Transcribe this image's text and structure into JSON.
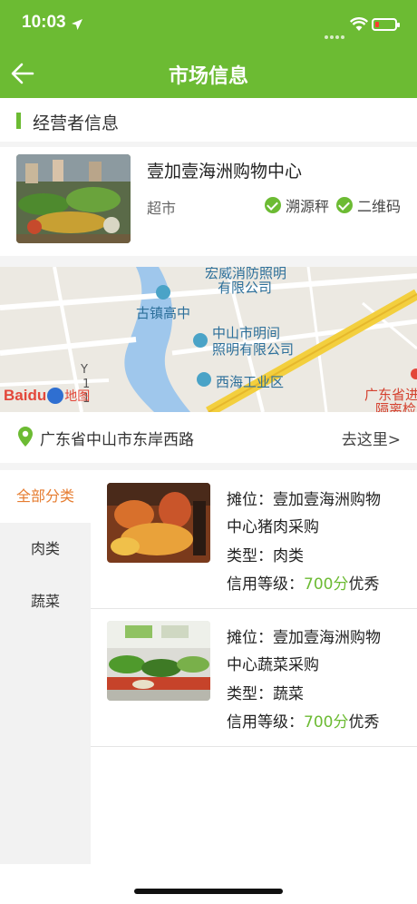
{
  "status": {
    "time": "10:03"
  },
  "nav": {
    "title": "市场信息"
  },
  "section": {
    "title": "经营者信息"
  },
  "vendor": {
    "name": "壹加壹海洲购物中心",
    "type": "超市",
    "tags": [
      "溯源秤",
      "二维码"
    ]
  },
  "map": {
    "labels": [
      "宏威消防照明",
      "有限公司",
      "古镇高中",
      "中山市明间",
      "照明有限公司",
      "西海工业区",
      "广东省进",
      "隔离检",
      "Baidu",
      "地图",
      "Y",
      "1",
      "1"
    ]
  },
  "address": {
    "text": "广东省中山市东岸西路",
    "go_label": "去这里>"
  },
  "categories": [
    {
      "label": "全部分类",
      "active": true
    },
    {
      "label": "肉类",
      "active": false
    },
    {
      "label": "蔬菜",
      "active": false
    }
  ],
  "stalls": [
    {
      "line1": "摊位：壹加壹海洲购物",
      "line2": "中心猪肉采购",
      "type_line": "类型：肉类",
      "credit_prefix": "信用等级：",
      "score": "700分",
      "grade": "优秀"
    },
    {
      "line1": "摊位：壹加壹海洲购物",
      "line2": "中心蔬菜采购",
      "type_line": "类型：蔬菜",
      "credit_prefix": "信用等级：",
      "score": "700分",
      "grade": "优秀"
    }
  ],
  "colors": {
    "brand": "#6cbb33",
    "active_category": "#e67d31",
    "score": "#6cbb33"
  },
  "icons": {
    "back": "back-arrow-icon",
    "location": "map-pin-icon",
    "check": "check-circle-icon",
    "location_arrow": "location-arrow-icon",
    "wifi": "wifi-icon",
    "battery": "battery-icon"
  }
}
